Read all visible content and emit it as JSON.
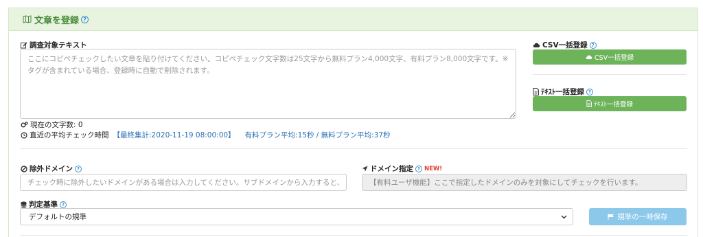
{
  "panel": {
    "title": "文章を登録",
    "help": "?"
  },
  "text_section": {
    "label": "調査対象テキスト",
    "placeholder": "ここにコピペチェックしたい文章を貼り付けてください。コピペチェック文字数は25文字から無料プラン4,000文字、有料プラン8,000文字です。※タグが含まれている場合、登録時に自動で削除されます。",
    "char_count_label": "現在の文字数: 0",
    "avg_check_label": "直近の平均チェック時間",
    "last_aggregated": "【最終集計:2020-11-19 08:00:00】",
    "plan_averages": "有料プラン平均:15秒 / 無料プラン平均:37秒"
  },
  "csv": {
    "label": "CSV一括登録",
    "button": "CSV一括登録"
  },
  "text_bulk": {
    "label": "ﾃｷｽﾄ一括登録",
    "button": "ﾃｷｽﾄ一括登録"
  },
  "exclude_domain": {
    "label": "除外ドメイン",
    "placeholder": "チェック時に除外したいドメインがある場合は入力してください。サブドメインから入力すると、"
  },
  "domain_spec": {
    "label": "ドメイン指定",
    "badge": "NEW!",
    "placeholder": "【有料ユーザ機能】ここで指定したドメインのみを対象にしてチェックを行います。"
  },
  "criteria": {
    "label": "判定基準",
    "selected": "デフォルトの規準",
    "save_button": "規準の一時保存"
  },
  "colors": {
    "header_bg": "#e8f4e0",
    "green_button": "#6db35a",
    "blue_button": "#8cc8ea",
    "link_blue": "#2a6fb5",
    "new_red": "#e03a2b"
  }
}
